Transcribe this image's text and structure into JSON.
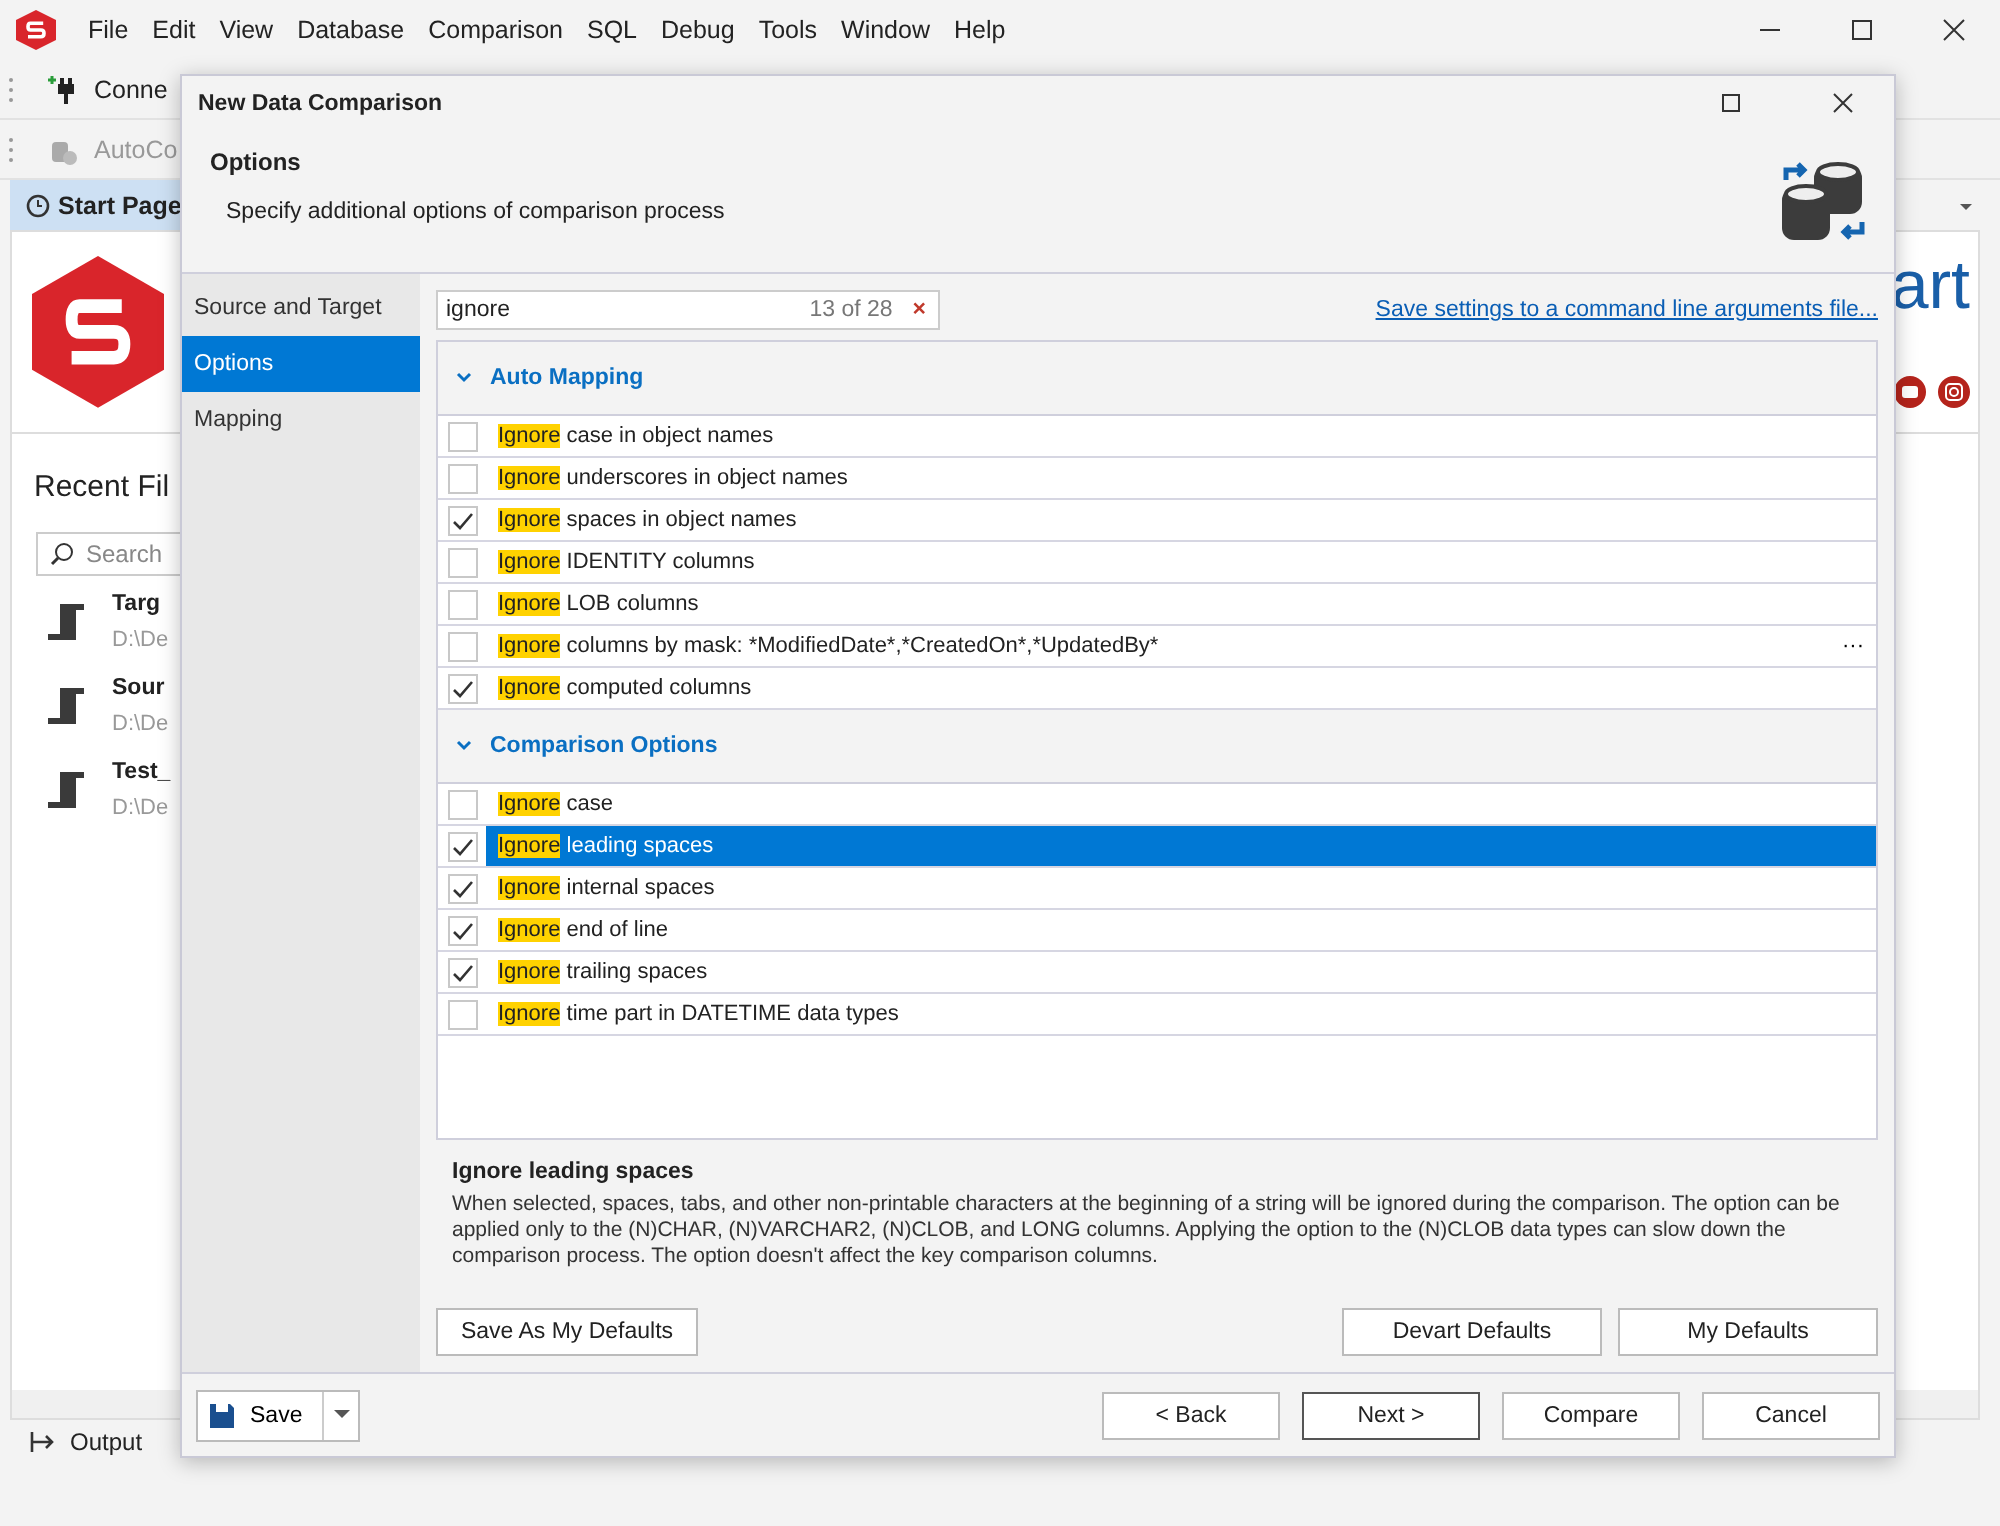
{
  "app": {
    "menu": [
      "File",
      "Edit",
      "View",
      "Database",
      "Comparison",
      "SQL",
      "Debug",
      "Tools",
      "Window",
      "Help"
    ],
    "toolbar": [
      {
        "label": "Conne",
        "disabled": false
      },
      {
        "label": "AutoCo",
        "disabled": true
      }
    ],
    "tab": {
      "label": "Start Page"
    },
    "start_page": {
      "recent_title": "Recent Fil",
      "search_placeholder": "Search",
      "brand": "art",
      "files": [
        {
          "name": "Targ",
          "path": "D:\\De"
        },
        {
          "name": "Sour",
          "path": "D:\\De"
        },
        {
          "name": "Test_",
          "path": "D:\\De"
        }
      ]
    },
    "output": "Output"
  },
  "dialog": {
    "title": "New Data Comparison",
    "header": "Options",
    "subtitle": "Specify additional options of comparison process",
    "nav": [
      {
        "label": "Source and Target",
        "selected": false
      },
      {
        "label": "Options",
        "selected": true
      },
      {
        "label": "Mapping",
        "selected": false
      }
    ],
    "search": {
      "value": "ignore",
      "count": "13 of 28",
      "clear": "×"
    },
    "link": "Save settings to a command line arguments file...",
    "groups": [
      {
        "title": "Auto Mapping",
        "expanded": true,
        "options": [
          {
            "match": "Ignore",
            "rest": " case in object names",
            "checked": false,
            "selected": false
          },
          {
            "match": "Ignore",
            "rest": " underscores in object names",
            "checked": false,
            "selected": false
          },
          {
            "match": "Ignore",
            "rest": " spaces in object names",
            "checked": true,
            "selected": false
          },
          {
            "match": "Ignore",
            "rest": " IDENTITY columns",
            "checked": false,
            "selected": false
          },
          {
            "match": "Ignore",
            "rest": " LOB columns",
            "checked": false,
            "selected": false
          },
          {
            "match": "Ignore",
            "rest": " columns by mask: *ModifiedDate*,*CreatedOn*,*UpdatedBy*",
            "checked": false,
            "selected": false,
            "button": "···"
          },
          {
            "match": "Ignore",
            "rest": " computed columns",
            "checked": true,
            "selected": false
          }
        ]
      },
      {
        "title": "Comparison Options",
        "expanded": true,
        "options": [
          {
            "match": "Ignore",
            "rest": " case",
            "checked": false,
            "selected": false
          },
          {
            "match": "Ignore",
            "rest": " leading spaces",
            "checked": true,
            "selected": true
          },
          {
            "match": "Ignore",
            "rest": " internal spaces",
            "checked": true,
            "selected": false
          },
          {
            "match": "Ignore",
            "rest": " end of line",
            "checked": true,
            "selected": false
          },
          {
            "match": "Ignore",
            "rest": " trailing spaces",
            "checked": true,
            "selected": false
          },
          {
            "match": "Ignore",
            "rest": " time part in DATETIME data types",
            "checked": false,
            "selected": false
          }
        ]
      }
    ],
    "description": {
      "title": "Ignore leading spaces",
      "text": "When selected, spaces, tabs, and other non-printable characters at the beginning of a string will be ignored during the comparison. The option can be applied only to the (N)CHAR, (N)VARCHAR2, (N)CLOB, and LONG columns. Applying the option to the (N)CLOB data types can slow down the comparison process. The option doesn't affect the key comparison columns."
    },
    "defaults_buttons": {
      "left": "Save As My Defaults",
      "right": [
        "Devart Defaults",
        "My Defaults"
      ]
    },
    "save": "Save",
    "footer_buttons": [
      "< Back",
      "Next >",
      "Compare",
      "Cancel"
    ]
  }
}
